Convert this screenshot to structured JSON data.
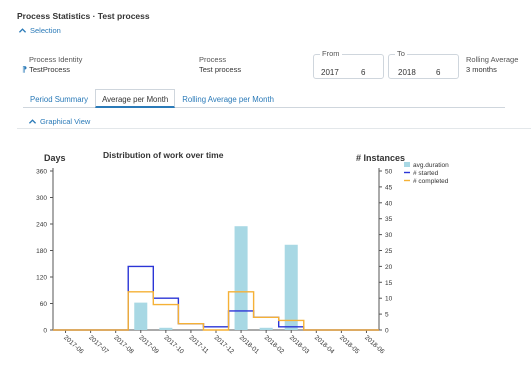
{
  "header": {
    "title": "Process Statistics · Test process"
  },
  "selection": {
    "toggle_label": "Selection"
  },
  "info": {
    "process_identity_label": "Process Identity",
    "process_identity_value": "TestProcess",
    "process_label": "Process",
    "process_value": "Test process",
    "from_label": "From",
    "from_year": "2017",
    "from_month": "6",
    "to_label": "To",
    "to_year": "2018",
    "to_month": "6",
    "rolling_label": "Rolling Average",
    "rolling_value": "3 months"
  },
  "tabs": [
    {
      "label": "Period Summary",
      "active": false
    },
    {
      "label": "Average per Month",
      "active": true
    },
    {
      "label": "Rolling Average per Month",
      "active": false
    }
  ],
  "graphical_view": {
    "toggle_label": "Graphical View"
  },
  "colors": {
    "bar": "#a8d8e4",
    "started": "#2b35d6",
    "completed": "#f5b136",
    "link": "#2a7ab8"
  },
  "chart_data": {
    "type": "bar",
    "title": "Distribution of work over time",
    "ylabel_left": "Days",
    "ylabel_right": "# Instances",
    "categories": [
      "2017-06",
      "2017-07",
      "2017-08",
      "2017-09",
      "2017-10",
      "2017-11",
      "2017-12",
      "2018-01",
      "2018-02",
      "2018-03",
      "2018-04",
      "2018-05",
      "2018-06"
    ],
    "ylim_left": [
      0,
      360
    ],
    "yticks_left": [
      0,
      60,
      120,
      180,
      240,
      300,
      360
    ],
    "ylim_right": [
      0,
      50
    ],
    "yticks_right": [
      0,
      5,
      10,
      15,
      20,
      25,
      30,
      35,
      40,
      45,
      50
    ],
    "legend_position": "top-right",
    "series": [
      {
        "name": "avg.duration",
        "kind": "bar",
        "axis": "left",
        "values": [
          0,
          0,
          0,
          62,
          5,
          0,
          0,
          235,
          5,
          193,
          0,
          0,
          0
        ]
      },
      {
        "name": "# started",
        "kind": "step",
        "axis": "right",
        "values": [
          0,
          0,
          0,
          20,
          10,
          2,
          1,
          6,
          4,
          1,
          0,
          0,
          0
        ]
      },
      {
        "name": "# completed",
        "kind": "step",
        "axis": "right",
        "values": [
          0,
          0,
          0,
          12,
          8,
          2,
          0,
          12,
          4,
          3,
          0,
          0,
          0
        ]
      }
    ]
  }
}
